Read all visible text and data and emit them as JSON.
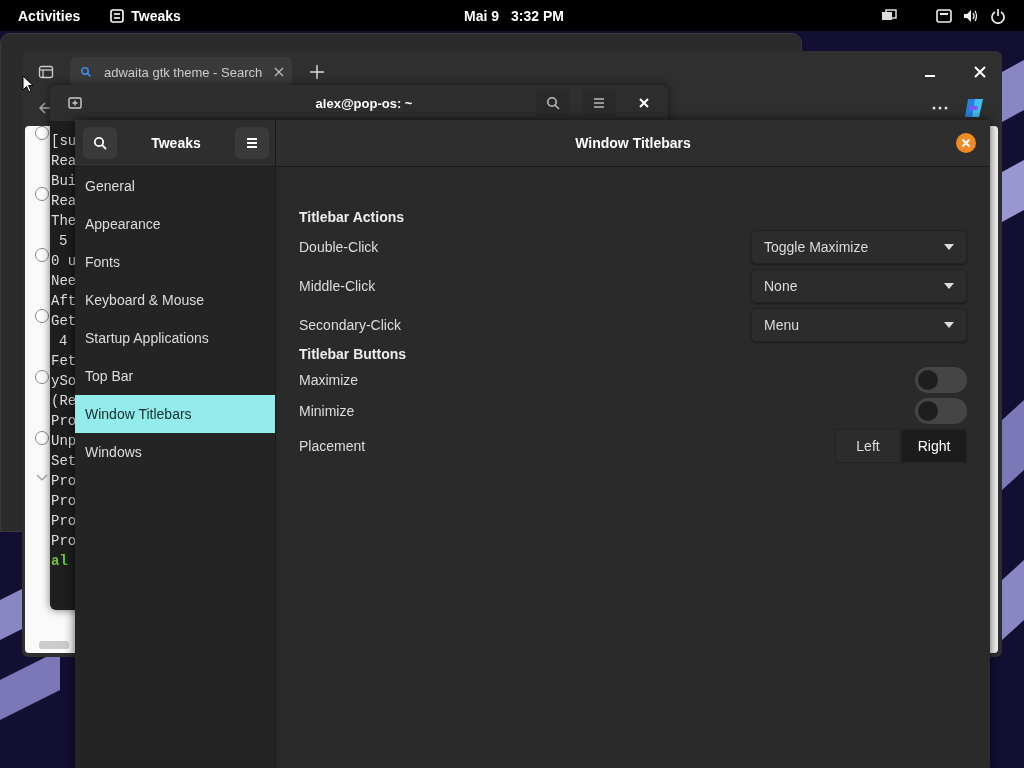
{
  "top_bar": {
    "activities": "Activities",
    "app": "Tweaks",
    "date": "Mai 9",
    "time": "3:32 PM"
  },
  "browser": {
    "tabs": [
      {
        "label": "adwaita gtk theme - Search",
        "selected": true
      }
    ]
  },
  "terminal": {
    "title": "alex@pop-os: ~",
    "lines": [
      {
        "text": "[su",
        "kind": "output"
      },
      {
        "text": "Rea",
        "kind": "output"
      },
      {
        "text": "Bui",
        "kind": "output"
      },
      {
        "text": "Rea",
        "kind": "output"
      },
      {
        "text": "The",
        "kind": "output"
      },
      {
        "text": "5",
        "kind": "indented"
      },
      {
        "text": "0 u",
        "kind": "output"
      },
      {
        "text": "Nee",
        "kind": "output"
      },
      {
        "text": "Aft",
        "kind": "output"
      },
      {
        "text": "Get",
        "kind": "output"
      },
      {
        "text": "4",
        "kind": "indented"
      },
      {
        "text": "Fet",
        "kind": "output"
      },
      {
        "text": "ySo",
        "kind": "output"
      },
      {
        "text": "(Re",
        "kind": "output"
      },
      {
        "text": "Pro",
        "kind": "output"
      },
      {
        "text": "Unp",
        "kind": "output"
      },
      {
        "text": "Set",
        "kind": "output"
      },
      {
        "text": "Pro",
        "kind": "output"
      },
      {
        "text": "Pro",
        "kind": "output"
      },
      {
        "text": "Pro",
        "kind": "output"
      },
      {
        "text": "Pro",
        "kind": "output"
      },
      {
        "text": "al",
        "kind": "prompt"
      }
    ]
  },
  "tweaks": {
    "title": "Tweaks",
    "page_title": "Window Titlebars",
    "sidebar": [
      {
        "label": "General",
        "selected": false
      },
      {
        "label": "Appearance",
        "selected": false
      },
      {
        "label": "Fonts",
        "selected": false
      },
      {
        "label": "Keyboard & Mouse",
        "selected": false
      },
      {
        "label": "Startup Applications",
        "selected": false
      },
      {
        "label": "Top Bar",
        "selected": false
      },
      {
        "label": "Window Titlebars",
        "selected": true
      },
      {
        "label": "Windows",
        "selected": false
      }
    ],
    "sections": [
      {
        "heading": "Titlebar Actions",
        "rows": [
          {
            "kind": "dropdown",
            "label": "Double-Click",
            "value": "Toggle Maximize"
          },
          {
            "kind": "dropdown",
            "label": "Middle-Click",
            "value": "None"
          },
          {
            "kind": "dropdown",
            "label": "Secondary-Click",
            "value": "Menu"
          }
        ]
      },
      {
        "heading": "Titlebar Buttons",
        "rows": [
          {
            "kind": "switch",
            "label": "Maximize",
            "on": false
          },
          {
            "kind": "switch",
            "label": "Minimize",
            "on": false
          },
          {
            "kind": "segmented",
            "label": "Placement",
            "options": [
              {
                "label": "Left",
                "selected": false
              },
              {
                "label": "Right",
                "selected": true
              }
            ]
          }
        ]
      }
    ]
  }
}
